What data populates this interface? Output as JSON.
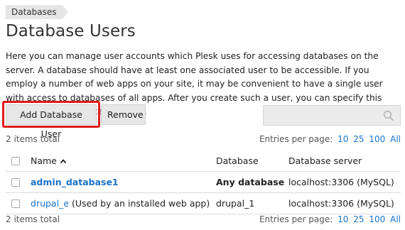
{
  "breadcrumb": {
    "label": "Databases"
  },
  "page": {
    "title": "Database Users",
    "description": "Here you can manage user accounts which Plesk uses for accessing databases on the server. A database should have at least one associated user to be accessible. If you employ a number of web apps on your site, it may be convenient to have a single user with access to databases of all apps. After you create such a user, you can specify this user during apps installallations."
  },
  "toolbar": {
    "add_label": "Add Database User",
    "remove_label": "Remove",
    "search_placeholder": "",
    "highlight_color": "#e01b1b"
  },
  "list": {
    "count_text": "2 items total",
    "entries_label": "Entries per page:",
    "page_sizes": [
      "10",
      "25",
      "100",
      "All"
    ],
    "columns": {
      "name": "Name",
      "database": "Database",
      "server": "Database server"
    },
    "rows": [
      {
        "name": "admin_database1",
        "note": "",
        "database": "Any database",
        "server": "localhost:3306 (MySQL)"
      },
      {
        "name": "drupal_e",
        "note": "(Used by an installed web app)",
        "database": "drupal_1",
        "server": "localhost:3306 (MySQL)"
      }
    ]
  },
  "colors": {
    "link": "#1a73c8",
    "button_bg": "#e7e7e7"
  }
}
